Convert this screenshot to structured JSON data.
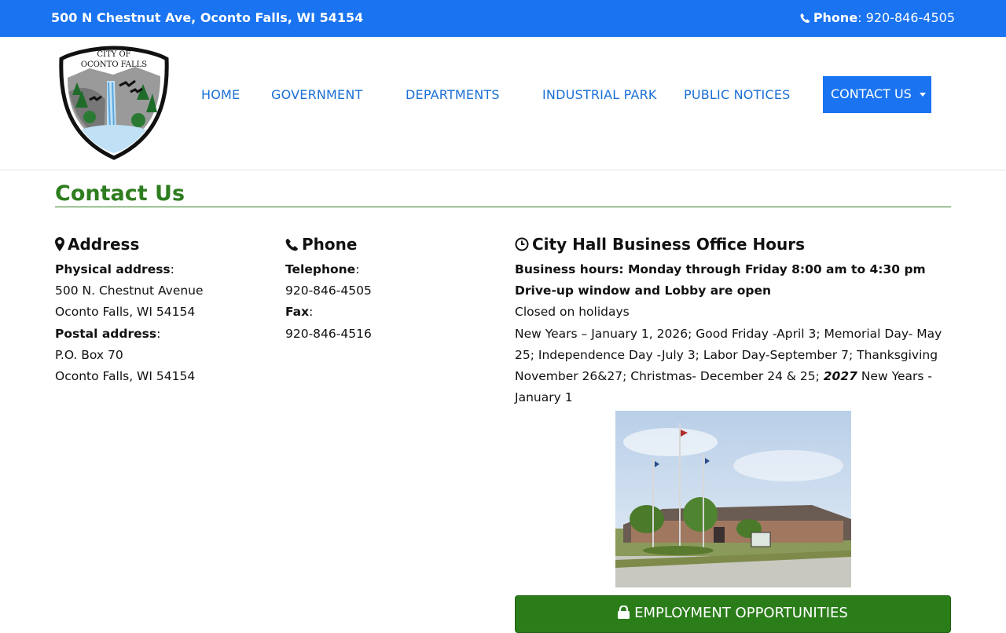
{
  "topbar": {
    "address": "500 N Chestnut Ave, Oconto Falls, WI 54154",
    "phone_label": "Phone",
    "phone_number": ": 920-846-4505"
  },
  "logo": {
    "line1": "CITY OF",
    "line2": "OCONTO FALLS"
  },
  "nav": {
    "items": [
      "HOME",
      "GOVERNMENT",
      "DEPARTMENTS",
      "INDUSTRIAL PARK",
      "PUBLIC NOTICES"
    ],
    "contact": "CONTACT US"
  },
  "page": {
    "title": "Contact Us"
  },
  "address": {
    "heading": "Address",
    "physical_label": "Physical address",
    "physical_line1": "500 N. Chestnut Avenue",
    "physical_line2": "Oconto Falls, WI 54154",
    "postal_label": "Postal address",
    "postal_line1": "P.O. Box 70",
    "postal_line2": "Oconto Falls, WI 54154"
  },
  "phone": {
    "heading": "Phone",
    "telephone_label": "Telephone",
    "telephone": "920-846-4505",
    "fax_label": "Fax",
    "fax": "920-846-4516"
  },
  "hours": {
    "heading": "City Hall Business Office Hours",
    "business_hours": "Business hours:  Monday through Friday 8:00 am to 4:30 pm",
    "driveup": "Drive-up window and Lobby are open",
    "closed": "Closed on holidays",
    "holidays_text": "New Years – January 1, 2026; Good Friday -April 3; Memorial Day- May 25; Independence Day -July 3; Labor Day-September 7;  Thanksgiving November 26&27; Christmas- December 24 & 25; ",
    "holidays_year": "2027",
    "holidays_tail": " New Years - January 1"
  },
  "employment": {
    "label": "EMPLOYMENT OPPORTUNITIES"
  },
  "colors": {
    "brand_blue": "#1a73f0",
    "nav_blue": "#1a6fd6",
    "title_green": "#2e7d1f",
    "button_green": "#2b7d1a"
  },
  "icons": {
    "phone": "phone-icon",
    "address": "map-marker-icon",
    "hours": "clock-icon",
    "employment": "lock-icon"
  }
}
